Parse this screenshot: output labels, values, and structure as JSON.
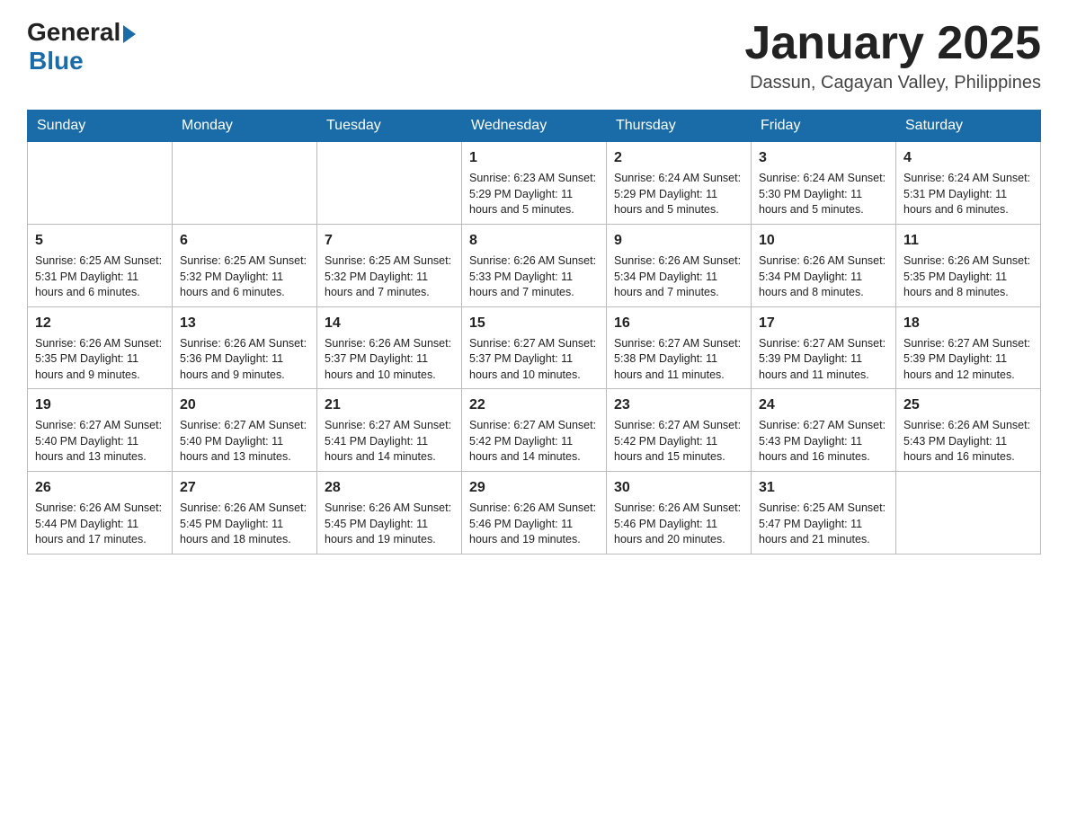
{
  "header": {
    "logo_general": "General",
    "logo_blue": "Blue",
    "month_title": "January 2025",
    "location": "Dassun, Cagayan Valley, Philippines"
  },
  "days_of_week": [
    "Sunday",
    "Monday",
    "Tuesday",
    "Wednesday",
    "Thursday",
    "Friday",
    "Saturday"
  ],
  "weeks": [
    [
      {
        "day": "",
        "info": ""
      },
      {
        "day": "",
        "info": ""
      },
      {
        "day": "",
        "info": ""
      },
      {
        "day": "1",
        "info": "Sunrise: 6:23 AM\nSunset: 5:29 PM\nDaylight: 11 hours and 5 minutes."
      },
      {
        "day": "2",
        "info": "Sunrise: 6:24 AM\nSunset: 5:29 PM\nDaylight: 11 hours and 5 minutes."
      },
      {
        "day": "3",
        "info": "Sunrise: 6:24 AM\nSunset: 5:30 PM\nDaylight: 11 hours and 5 minutes."
      },
      {
        "day": "4",
        "info": "Sunrise: 6:24 AM\nSunset: 5:31 PM\nDaylight: 11 hours and 6 minutes."
      }
    ],
    [
      {
        "day": "5",
        "info": "Sunrise: 6:25 AM\nSunset: 5:31 PM\nDaylight: 11 hours and 6 minutes."
      },
      {
        "day": "6",
        "info": "Sunrise: 6:25 AM\nSunset: 5:32 PM\nDaylight: 11 hours and 6 minutes."
      },
      {
        "day": "7",
        "info": "Sunrise: 6:25 AM\nSunset: 5:32 PM\nDaylight: 11 hours and 7 minutes."
      },
      {
        "day": "8",
        "info": "Sunrise: 6:26 AM\nSunset: 5:33 PM\nDaylight: 11 hours and 7 minutes."
      },
      {
        "day": "9",
        "info": "Sunrise: 6:26 AM\nSunset: 5:34 PM\nDaylight: 11 hours and 7 minutes."
      },
      {
        "day": "10",
        "info": "Sunrise: 6:26 AM\nSunset: 5:34 PM\nDaylight: 11 hours and 8 minutes."
      },
      {
        "day": "11",
        "info": "Sunrise: 6:26 AM\nSunset: 5:35 PM\nDaylight: 11 hours and 8 minutes."
      }
    ],
    [
      {
        "day": "12",
        "info": "Sunrise: 6:26 AM\nSunset: 5:35 PM\nDaylight: 11 hours and 9 minutes."
      },
      {
        "day": "13",
        "info": "Sunrise: 6:26 AM\nSunset: 5:36 PM\nDaylight: 11 hours and 9 minutes."
      },
      {
        "day": "14",
        "info": "Sunrise: 6:26 AM\nSunset: 5:37 PM\nDaylight: 11 hours and 10 minutes."
      },
      {
        "day": "15",
        "info": "Sunrise: 6:27 AM\nSunset: 5:37 PM\nDaylight: 11 hours and 10 minutes."
      },
      {
        "day": "16",
        "info": "Sunrise: 6:27 AM\nSunset: 5:38 PM\nDaylight: 11 hours and 11 minutes."
      },
      {
        "day": "17",
        "info": "Sunrise: 6:27 AM\nSunset: 5:39 PM\nDaylight: 11 hours and 11 minutes."
      },
      {
        "day": "18",
        "info": "Sunrise: 6:27 AM\nSunset: 5:39 PM\nDaylight: 11 hours and 12 minutes."
      }
    ],
    [
      {
        "day": "19",
        "info": "Sunrise: 6:27 AM\nSunset: 5:40 PM\nDaylight: 11 hours and 13 minutes."
      },
      {
        "day": "20",
        "info": "Sunrise: 6:27 AM\nSunset: 5:40 PM\nDaylight: 11 hours and 13 minutes."
      },
      {
        "day": "21",
        "info": "Sunrise: 6:27 AM\nSunset: 5:41 PM\nDaylight: 11 hours and 14 minutes."
      },
      {
        "day": "22",
        "info": "Sunrise: 6:27 AM\nSunset: 5:42 PM\nDaylight: 11 hours and 14 minutes."
      },
      {
        "day": "23",
        "info": "Sunrise: 6:27 AM\nSunset: 5:42 PM\nDaylight: 11 hours and 15 minutes."
      },
      {
        "day": "24",
        "info": "Sunrise: 6:27 AM\nSunset: 5:43 PM\nDaylight: 11 hours and 16 minutes."
      },
      {
        "day": "25",
        "info": "Sunrise: 6:26 AM\nSunset: 5:43 PM\nDaylight: 11 hours and 16 minutes."
      }
    ],
    [
      {
        "day": "26",
        "info": "Sunrise: 6:26 AM\nSunset: 5:44 PM\nDaylight: 11 hours and 17 minutes."
      },
      {
        "day": "27",
        "info": "Sunrise: 6:26 AM\nSunset: 5:45 PM\nDaylight: 11 hours and 18 minutes."
      },
      {
        "day": "28",
        "info": "Sunrise: 6:26 AM\nSunset: 5:45 PM\nDaylight: 11 hours and 19 minutes."
      },
      {
        "day": "29",
        "info": "Sunrise: 6:26 AM\nSunset: 5:46 PM\nDaylight: 11 hours and 19 minutes."
      },
      {
        "day": "30",
        "info": "Sunrise: 6:26 AM\nSunset: 5:46 PM\nDaylight: 11 hours and 20 minutes."
      },
      {
        "day": "31",
        "info": "Sunrise: 6:25 AM\nSunset: 5:47 PM\nDaylight: 11 hours and 21 minutes."
      },
      {
        "day": "",
        "info": ""
      }
    ]
  ]
}
